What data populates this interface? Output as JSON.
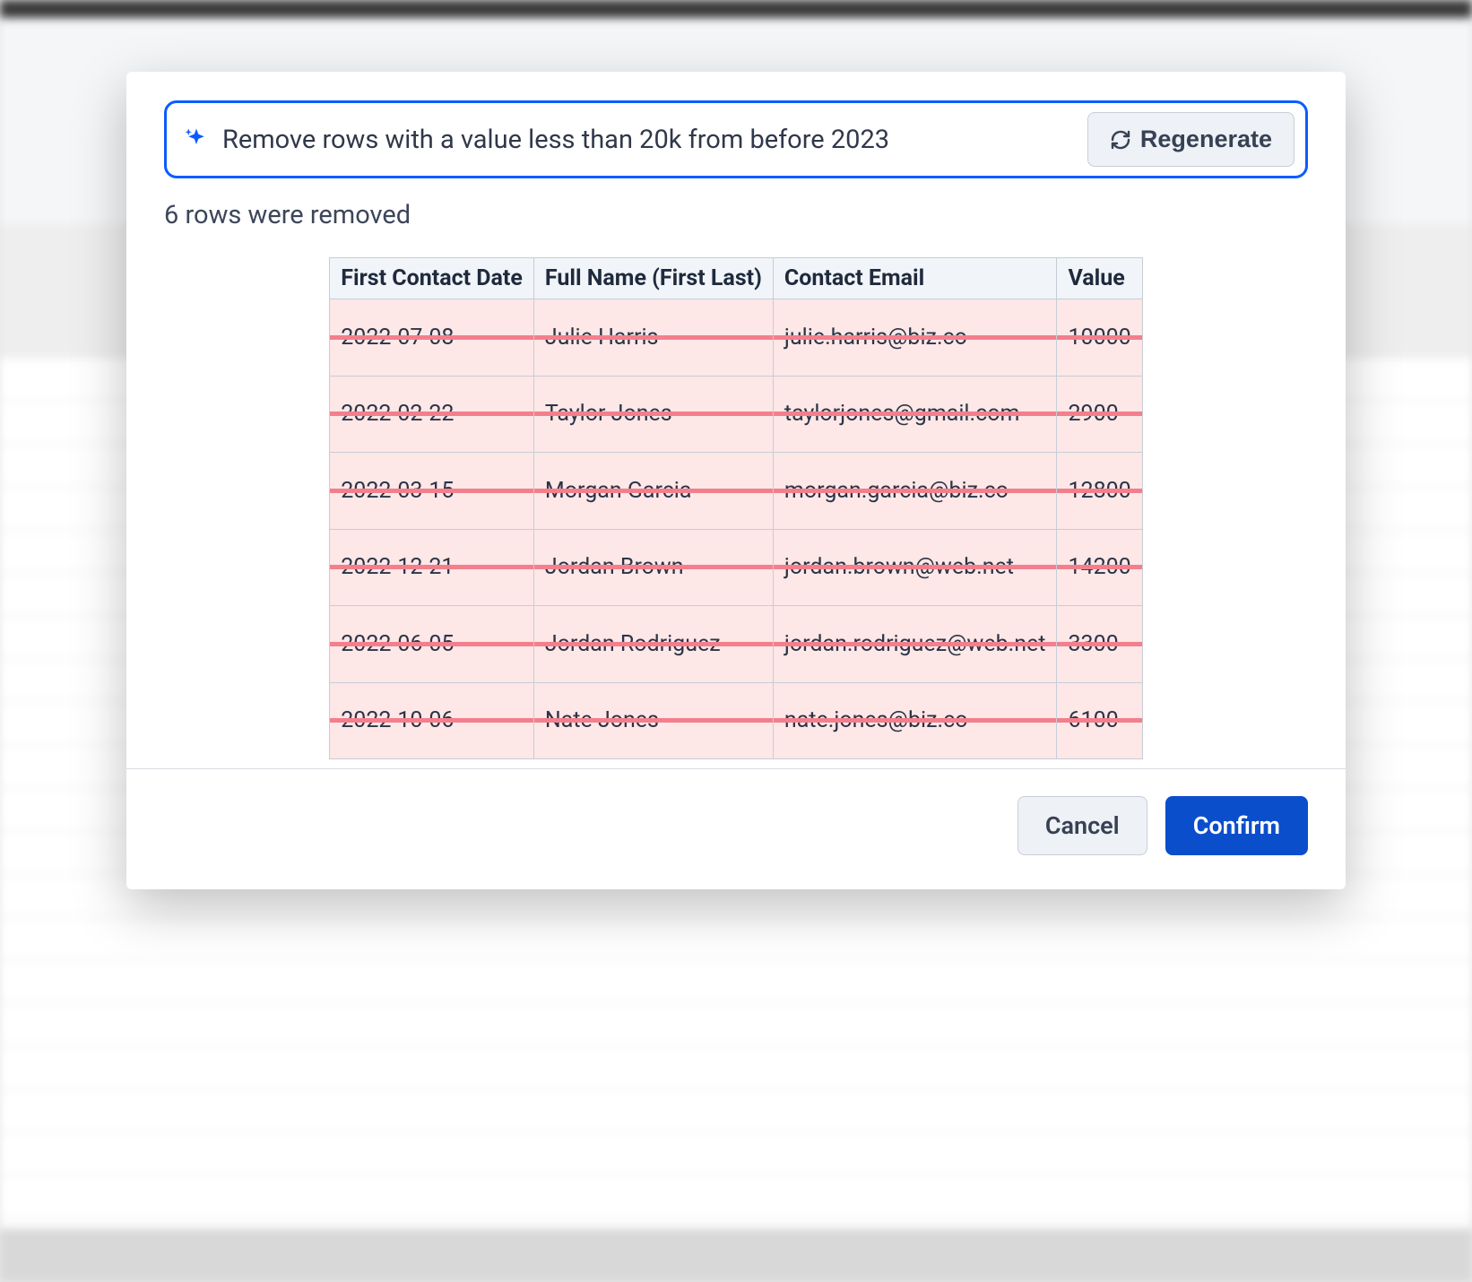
{
  "prompt": {
    "value": "Remove rows with a value less than 20k from before 2023",
    "regenerate_label": "Regenerate"
  },
  "status_text": "6 rows were removed",
  "table": {
    "headers": [
      "First Contact Date",
      "Full Name (First Last)",
      "Contact Email",
      "Value"
    ],
    "rows": [
      {
        "date": "2022-07-08",
        "name": "Julie Harris",
        "email": "julie.harris@biz.co",
        "value": "10000"
      },
      {
        "date": "2022-02-22",
        "name": "Taylor Jones",
        "email": "taylorjones@gmail.com",
        "value": "2900"
      },
      {
        "date": "2022-03-15",
        "name": "Morgan Garcia",
        "email": "morgan.garcia@biz.co",
        "value": "12800"
      },
      {
        "date": "2022-12-21",
        "name": "Jordan Brown",
        "email": "jordan.brown@web.net",
        "value": "14200"
      },
      {
        "date": "2022-06-05",
        "name": "Jordan Rodriguez",
        "email": "jordan.rodriguez@web.net",
        "value": "3300"
      },
      {
        "date": "2022-10-06",
        "name": "Nate Jones",
        "email": "nate.jones@biz.co",
        "value": "6100"
      }
    ]
  },
  "footer": {
    "cancel_label": "Cancel",
    "confirm_label": "Confirm"
  }
}
